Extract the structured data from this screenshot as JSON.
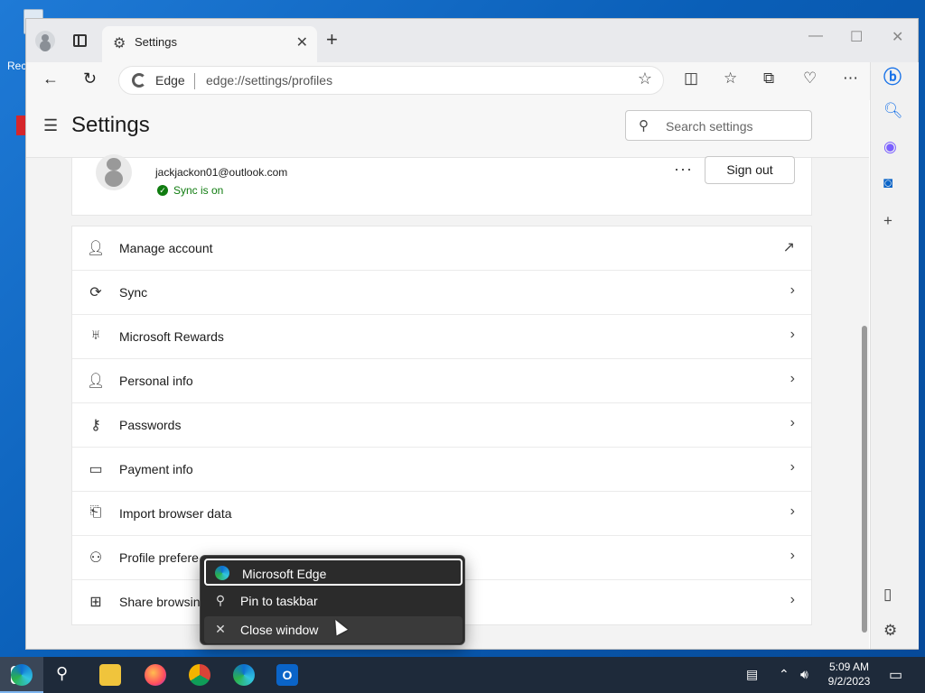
{
  "desktop": {
    "recycle_label": "Rec"
  },
  "browser": {
    "tab_title": "Settings",
    "address_site": "Edge",
    "address_url": "edge://settings/profiles"
  },
  "settings": {
    "title": "Settings",
    "search_placeholder": "Search settings",
    "profile": {
      "email": "jackjackon01@outlook.com",
      "sync_status": "Sync is on",
      "sign_out": "Sign out"
    },
    "items": [
      {
        "label": "Manage account",
        "icon": "person-icon",
        "action": "external-link-icon"
      },
      {
        "label": "Sync",
        "icon": "sync-icon",
        "action": "chevron-right-icon"
      },
      {
        "label": "Microsoft Rewards",
        "icon": "trophy-icon",
        "action": "chevron-right-icon"
      },
      {
        "label": "Personal info",
        "icon": "person-card-icon",
        "action": "chevron-right-icon"
      },
      {
        "label": "Passwords",
        "icon": "key-icon",
        "action": "chevron-right-icon"
      },
      {
        "label": "Payment info",
        "icon": "credit-card-icon",
        "action": "chevron-right-icon"
      },
      {
        "label": "Import browser data",
        "icon": "import-icon",
        "action": "chevron-right-icon"
      },
      {
        "label": "Profile prefere",
        "icon": "people-settings-icon",
        "action": "chevron-right-icon"
      },
      {
        "label": "Share browsin",
        "icon": "windows-icon",
        "action": "chevron-right-icon"
      }
    ]
  },
  "context_menu": {
    "items": [
      {
        "label": "Microsoft Edge",
        "icon": "edge-icon"
      },
      {
        "label": "Pin to taskbar",
        "icon": "pin-icon"
      },
      {
        "label": "Close window",
        "icon": "close-icon"
      }
    ]
  },
  "taskbar": {
    "time": "5:09 AM",
    "date": "9/2/2023"
  }
}
